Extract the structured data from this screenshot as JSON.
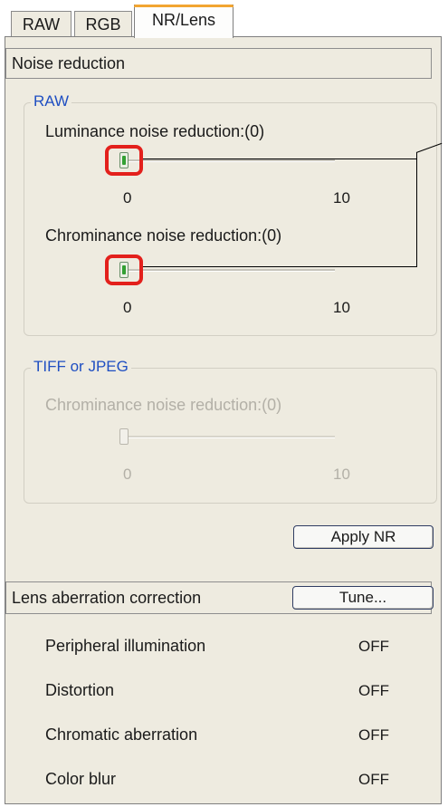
{
  "tabs": [
    {
      "label": "RAW"
    },
    {
      "label": "RGB"
    },
    {
      "label": "NR/Lens",
      "active": true
    }
  ],
  "noise_reduction": {
    "header": "Noise reduction",
    "raw_group": {
      "title": "RAW",
      "luminance": {
        "label": "Luminance noise reduction:(0)",
        "value": 0,
        "min_label": "0",
        "max_label": "10"
      },
      "chrominance": {
        "label": "Chrominance noise reduction:(0)",
        "value": 0,
        "min_label": "0",
        "max_label": "10"
      }
    },
    "tiff_group": {
      "title": "TIFF or JPEG",
      "chrominance": {
        "label": "Chrominance noise reduction:(0)",
        "value": 0,
        "min_label": "0",
        "max_label": "10",
        "disabled": true
      }
    },
    "apply_button": "Apply NR"
  },
  "lens": {
    "header": "Lens aberration correction",
    "tune_button": "Tune...",
    "rows": [
      {
        "label": "Peripheral illumination",
        "value": "OFF"
      },
      {
        "label": "Distortion",
        "value": "OFF"
      },
      {
        "label": "Chromatic aberration",
        "value": "OFF"
      },
      {
        "label": "Color blur",
        "value": "OFF"
      }
    ]
  },
  "colors": {
    "accent_tab": "#f2a531",
    "group_title": "#1f4fc2",
    "callout": "#e3201c"
  }
}
